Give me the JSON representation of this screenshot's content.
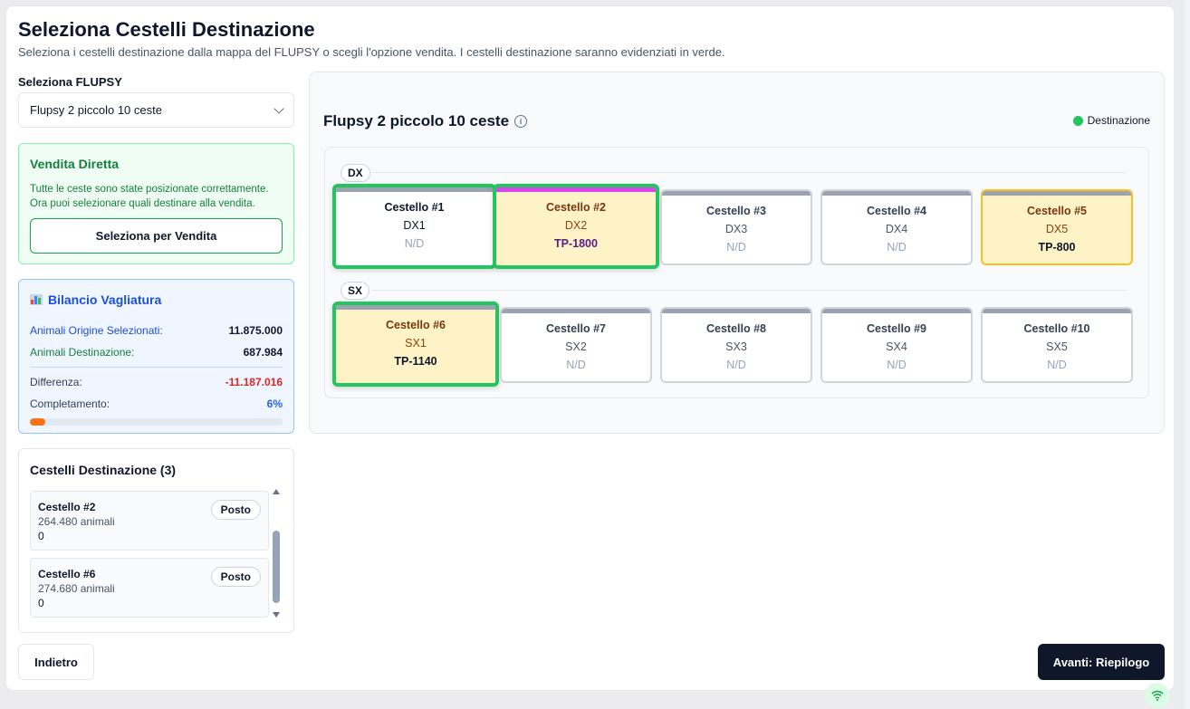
{
  "dialog": {
    "title": "Seleziona Cestelli Destinazione",
    "subtitle": "Seleziona i cestelli destinazione dalla mappa del FLUPSY o scegli l'opzione vendita. I cestelli destinazione saranno evidenziati in verde."
  },
  "flupsy_select": {
    "label": "Seleziona FLUPSY",
    "value": "Flupsy 2 piccolo 10 ceste"
  },
  "vendita": {
    "title": "Vendita Diretta",
    "line1": "Tutte le ceste sono state posizionate correttamente.",
    "line2": "Ora puoi selezionare quali destinare alla vendita.",
    "button": "Seleziona per Vendita"
  },
  "bilancio": {
    "title": "Bilancio Vagliatura",
    "origine_label": "Animali Origine Selezionati:",
    "origine_value": "11.875.000",
    "destinazione_label": "Animali Destinazione:",
    "destinazione_value": "687.984",
    "differenza_label": "Differenza:",
    "differenza_value": "-11.187.016",
    "completamento_label": "Completamento:",
    "completamento_value": "6%",
    "progress_fraction": 0.06
  },
  "destinazione": {
    "title": "Cestelli Destinazione (3)",
    "items": [
      {
        "name": "Cestello #2",
        "animals": "264.480 animali",
        "extra": "0",
        "badge": "Posto"
      },
      {
        "name": "Cestello #6",
        "animals": "274.680 animali",
        "extra": "0",
        "badge": "Posto"
      }
    ]
  },
  "map": {
    "title": "Flupsy 2 piccolo 10 ceste",
    "legend": "Destinazione",
    "legend_color": "#22c55e",
    "rows": [
      {
        "label": "DX",
        "cells": [
          {
            "name": "Cestello #1",
            "pos": "DX1",
            "code": "N/D"
          },
          {
            "name": "Cestello #2",
            "pos": "DX2",
            "code": "TP-1800"
          },
          {
            "name": "Cestello #3",
            "pos": "DX3",
            "code": "N/D"
          },
          {
            "name": "Cestello #4",
            "pos": "DX4",
            "code": "N/D"
          },
          {
            "name": "Cestello #5",
            "pos": "DX5",
            "code": "TP-800"
          }
        ]
      },
      {
        "label": "SX",
        "cells": [
          {
            "name": "Cestello #6",
            "pos": "SX1",
            "code": "TP-1140"
          },
          {
            "name": "Cestello #7",
            "pos": "SX2",
            "code": "N/D"
          },
          {
            "name": "Cestello #8",
            "pos": "SX3",
            "code": "N/D"
          },
          {
            "name": "Cestello #9",
            "pos": "SX4",
            "code": "N/D"
          },
          {
            "name": "Cestello #10",
            "pos": "SX5",
            "code": "N/D"
          }
        ]
      }
    ]
  },
  "footer": {
    "back": "Indietro",
    "next": "Avanti: Riepilogo"
  }
}
